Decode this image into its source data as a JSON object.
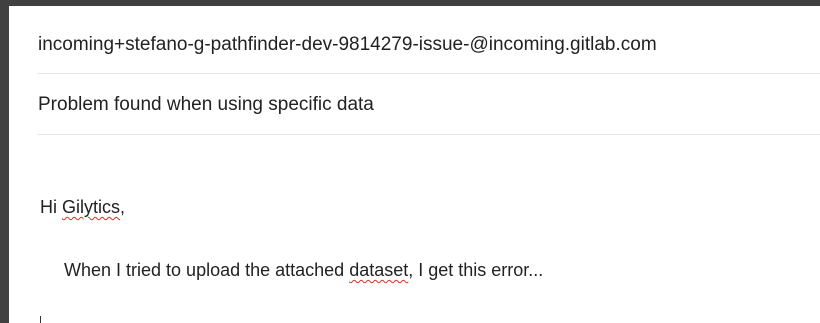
{
  "compose": {
    "to_value": "incoming+stefano-g-pathfinder-dev-9814279-issue-@incoming.gitlab.com",
    "subject_value": "Problem found when using specific data",
    "body": {
      "greeting_prefix": "Hi ",
      "greeting_name": "Gilytics",
      "greeting_suffix": ",",
      "message_prefix": "When I tried to upload the attached ",
      "message_word": "dataset",
      "message_suffix": ", I get this error..."
    }
  }
}
